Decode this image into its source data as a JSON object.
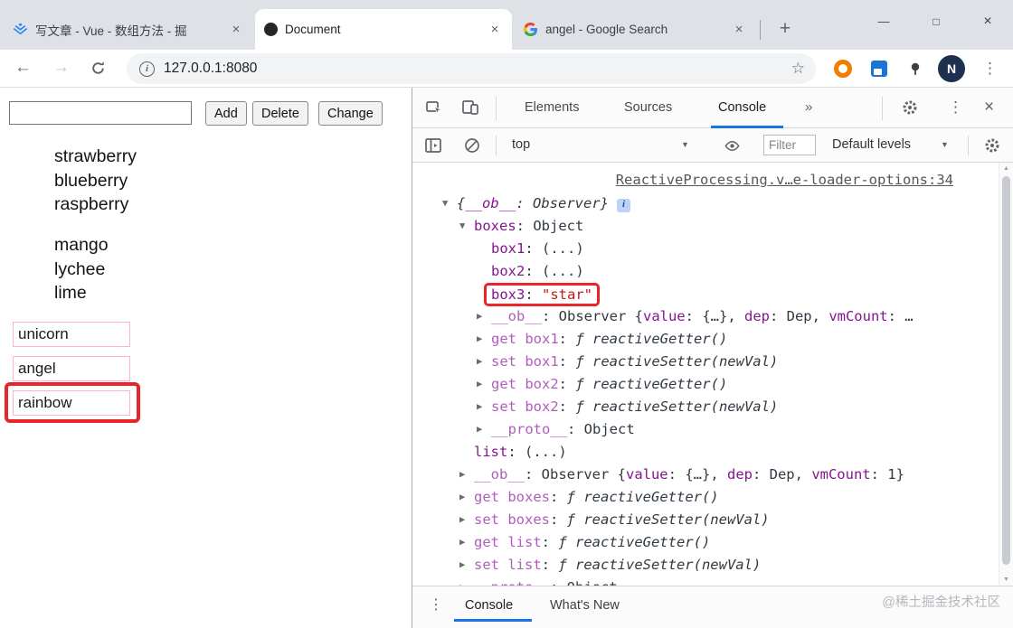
{
  "browser": {
    "tabs": [
      {
        "title": "写文章 - Vue - 数组方法 - 掘"
      },
      {
        "title": "Document"
      },
      {
        "title": "angel - Google Search"
      }
    ],
    "window_controls": {
      "minimize": "—",
      "maximize": "□",
      "close": "×"
    },
    "url": "127.0.0.1:8080",
    "avatar_letter": "N",
    "icons": {
      "back": "←",
      "forward": "→",
      "star": "☆",
      "menu": "⋮",
      "info": "i",
      "new_tab": "+",
      "close": "×"
    }
  },
  "page": {
    "controls": {
      "add": "Add",
      "delete": "Delete",
      "change": "Change"
    },
    "fruits_a": [
      "strawberry",
      "blueberry",
      "raspberry"
    ],
    "fruits_b": [
      "mango",
      "lychee",
      "lime"
    ],
    "inputs": {
      "first": "unicorn",
      "second": "angel",
      "third": "rainbow"
    }
  },
  "devtools": {
    "tabs": {
      "elements": "Elements",
      "sources": "Sources",
      "console": "Console"
    },
    "icons": {
      "more_tabs": "»",
      "menu": "⋮",
      "close": "×",
      "caret": "▼",
      "scroll_up": "▲",
      "scroll_down": "▼"
    },
    "toolbar": {
      "context": "top",
      "filter_placeholder": "Filter",
      "levels": "Default levels"
    },
    "source_link": "ReactiveProcessing.v…e-loader-options:34",
    "console_lines": [
      {
        "indent": 0,
        "exp": "▼",
        "info": true,
        "parts": [
          {
            "t": "{",
            "c": "it"
          },
          {
            "t": "__ob__",
            "c": "keyit"
          },
          {
            "t": ": ",
            "c": "it"
          },
          {
            "t": "Observer",
            "c": "it"
          },
          {
            "t": "}",
            "c": "it"
          }
        ]
      },
      {
        "indent": 1,
        "exp": "▼",
        "parts": [
          {
            "t": "boxes",
            "c": "key"
          },
          {
            "t": ": ",
            "c": "p"
          },
          {
            "t": "Object",
            "c": "p"
          }
        ]
      },
      {
        "indent": 2,
        "exp": "",
        "parts": [
          {
            "t": "box1",
            "c": "key"
          },
          {
            "t": ": ",
            "c": "p"
          },
          {
            "t": "(...)",
            "c": "p"
          }
        ]
      },
      {
        "indent": 2,
        "exp": "",
        "parts": [
          {
            "t": "box2",
            "c": "key"
          },
          {
            "t": ": ",
            "c": "p"
          },
          {
            "t": "(...)",
            "c": "p"
          }
        ]
      },
      {
        "indent": 2,
        "exp": "",
        "hl": true,
        "parts": [
          {
            "t": "box3",
            "c": "key"
          },
          {
            "t": ": ",
            "c": "p"
          },
          {
            "t": "\"star\"",
            "c": "str"
          }
        ]
      },
      {
        "indent": 2,
        "exp": "▶",
        "parts": [
          {
            "t": "__ob__",
            "c": "kdim"
          },
          {
            "t": ": Observer {",
            "c": "p"
          },
          {
            "t": "value",
            "c": "key"
          },
          {
            "t": ": {…}, ",
            "c": "p"
          },
          {
            "t": "dep",
            "c": "key"
          },
          {
            "t": ": Dep, ",
            "c": "p"
          },
          {
            "t": "vmCount",
            "c": "key"
          },
          {
            "t": ": …",
            "c": "p"
          }
        ]
      },
      {
        "indent": 2,
        "exp": "▶",
        "parts": [
          {
            "t": "get box1",
            "c": "kdim"
          },
          {
            "t": ": ",
            "c": "p"
          },
          {
            "t": "ƒ reactiveGetter()",
            "c": "fn"
          }
        ]
      },
      {
        "indent": 2,
        "exp": "▶",
        "parts": [
          {
            "t": "set box1",
            "c": "kdim"
          },
          {
            "t": ": ",
            "c": "p"
          },
          {
            "t": "ƒ reactiveSetter(newVal)",
            "c": "fn"
          }
        ]
      },
      {
        "indent": 2,
        "exp": "▶",
        "parts": [
          {
            "t": "get box2",
            "c": "kdim"
          },
          {
            "t": ": ",
            "c": "p"
          },
          {
            "t": "ƒ reactiveGetter()",
            "c": "fn"
          }
        ]
      },
      {
        "indent": 2,
        "exp": "▶",
        "parts": [
          {
            "t": "set box2",
            "c": "kdim"
          },
          {
            "t": ": ",
            "c": "p"
          },
          {
            "t": "ƒ reactiveSetter(newVal)",
            "c": "fn"
          }
        ]
      },
      {
        "indent": 2,
        "exp": "▶",
        "parts": [
          {
            "t": "__proto__",
            "c": "kdim"
          },
          {
            "t": ": ",
            "c": "p"
          },
          {
            "t": "Object",
            "c": "p"
          }
        ]
      },
      {
        "indent": 1,
        "exp": "",
        "parts": [
          {
            "t": "list",
            "c": "key"
          },
          {
            "t": ": ",
            "c": "p"
          },
          {
            "t": "(...)",
            "c": "p"
          }
        ]
      },
      {
        "indent": 1,
        "exp": "▶",
        "parts": [
          {
            "t": "__ob__",
            "c": "kdim"
          },
          {
            "t": ": Observer {",
            "c": "p"
          },
          {
            "t": "value",
            "c": "key"
          },
          {
            "t": ": {…}, ",
            "c": "p"
          },
          {
            "t": "dep",
            "c": "key"
          },
          {
            "t": ": Dep, ",
            "c": "p"
          },
          {
            "t": "vmCount",
            "c": "key"
          },
          {
            "t": ": 1}",
            "c": "p"
          }
        ]
      },
      {
        "indent": 1,
        "exp": "▶",
        "parts": [
          {
            "t": "get boxes",
            "c": "kdim"
          },
          {
            "t": ": ",
            "c": "p"
          },
          {
            "t": "ƒ reactiveGetter()",
            "c": "fn"
          }
        ]
      },
      {
        "indent": 1,
        "exp": "▶",
        "parts": [
          {
            "t": "set boxes",
            "c": "kdim"
          },
          {
            "t": ": ",
            "c": "p"
          },
          {
            "t": "ƒ reactiveSetter(newVal)",
            "c": "fn"
          }
        ]
      },
      {
        "indent": 1,
        "exp": "▶",
        "parts": [
          {
            "t": "get list",
            "c": "kdim"
          },
          {
            "t": ": ",
            "c": "p"
          },
          {
            "t": "ƒ reactiveGetter()",
            "c": "fn"
          }
        ]
      },
      {
        "indent": 1,
        "exp": "▶",
        "parts": [
          {
            "t": "set list",
            "c": "kdim"
          },
          {
            "t": ": ",
            "c": "p"
          },
          {
            "t": "ƒ reactiveSetter(newVal)",
            "c": "fn"
          }
        ]
      },
      {
        "indent": 1,
        "exp": "▶",
        "parts": [
          {
            "t": "__proto__",
            "c": "kdim"
          },
          {
            "t": ": ",
            "c": "p"
          },
          {
            "t": "Object",
            "c": "p"
          }
        ]
      }
    ],
    "drawer": {
      "console_tab": "Console",
      "whats_new": "What's New"
    },
    "watermark": "@稀土掘金技术社区"
  },
  "colors": {
    "accent": "#1a73e8",
    "key": "#881391",
    "key_dim": "#b05ebc",
    "string": "#c41a16",
    "annotation": "#e8262a",
    "pink_border": "#ffb6c1"
  }
}
